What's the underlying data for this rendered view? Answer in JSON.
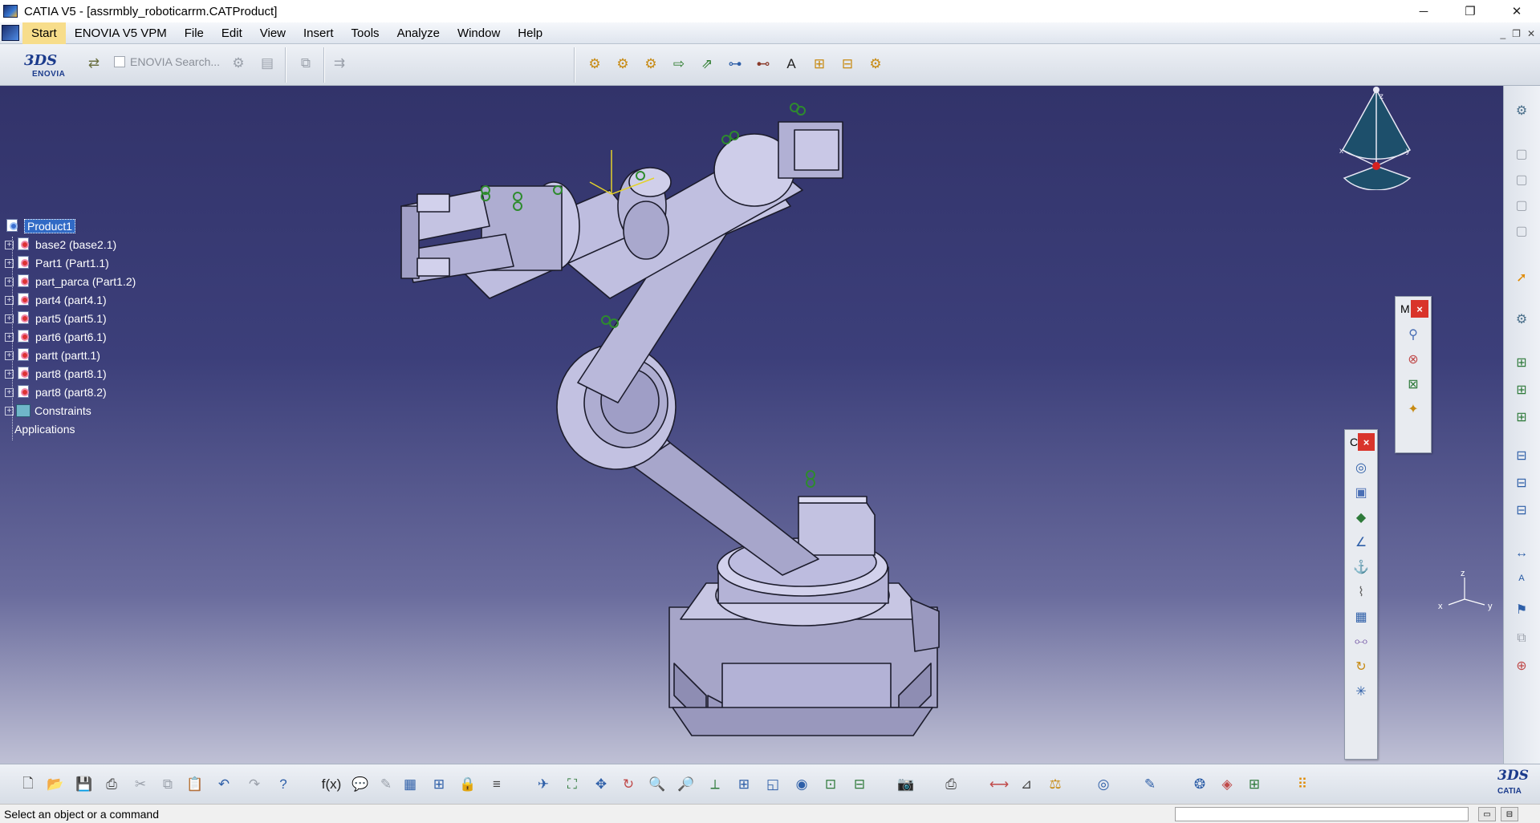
{
  "window": {
    "title": "CATIA V5 - [assrmbly_roboticarrm.CATProduct]",
    "controls": [
      "─",
      "❐",
      "✕"
    ]
  },
  "menu": {
    "items": [
      "Start",
      "ENOVIA V5 VPM",
      "File",
      "Edit",
      "View",
      "Insert",
      "Tools",
      "Analyze",
      "Window",
      "Help"
    ],
    "doc_controls": [
      "_",
      "❐",
      "✕"
    ]
  },
  "top_toolbar": {
    "enovia_logo_ds": "3DS",
    "enovia_logo_text": "ENOVIA",
    "search_label": "ENOVIA Search...",
    "icons": [
      "gear-icon",
      "gear-icon",
      "gear-icon",
      "export-icon",
      "export-icon",
      "tree-icon",
      "tree-icon",
      "text-icon",
      "tree-icon",
      "tree-icon",
      "gear-icon"
    ]
  },
  "spec_tree": {
    "root": "Product1",
    "items": [
      "base2 (base2.1)",
      "Part1 (Part1.1)",
      "part_parca (Part1.2)",
      "part4 (part4.1)",
      "part5 (part5.1)",
      "part6 (part6.1)",
      "partt (partt.1)",
      "part8 (part8.1)",
      "part8 (part8.2)"
    ],
    "constraints": "Constraints",
    "applications": "Applications"
  },
  "compass": {
    "x": "x",
    "y": "y",
    "z": "z"
  },
  "mini_axes": {
    "x": "x",
    "y": "y",
    "z": "z"
  },
  "floating_toolbars": [
    {
      "title": "M",
      "close": "×"
    },
    {
      "title": "C",
      "close": "×"
    }
  ],
  "colors": {
    "viewport_top": "#32336a",
    "viewport_bottom": "#bfc0d5",
    "model_fill": "#b9b8da",
    "model_edge": "#1c1c2c",
    "tree_selection": "#316ac5",
    "close_red": "#d9342b"
  },
  "bottom_toolbar": {
    "catia_logo_ds": "3DS",
    "catia_logo_text": "CATIA"
  },
  "status": {
    "message": "Select an object or a command"
  }
}
